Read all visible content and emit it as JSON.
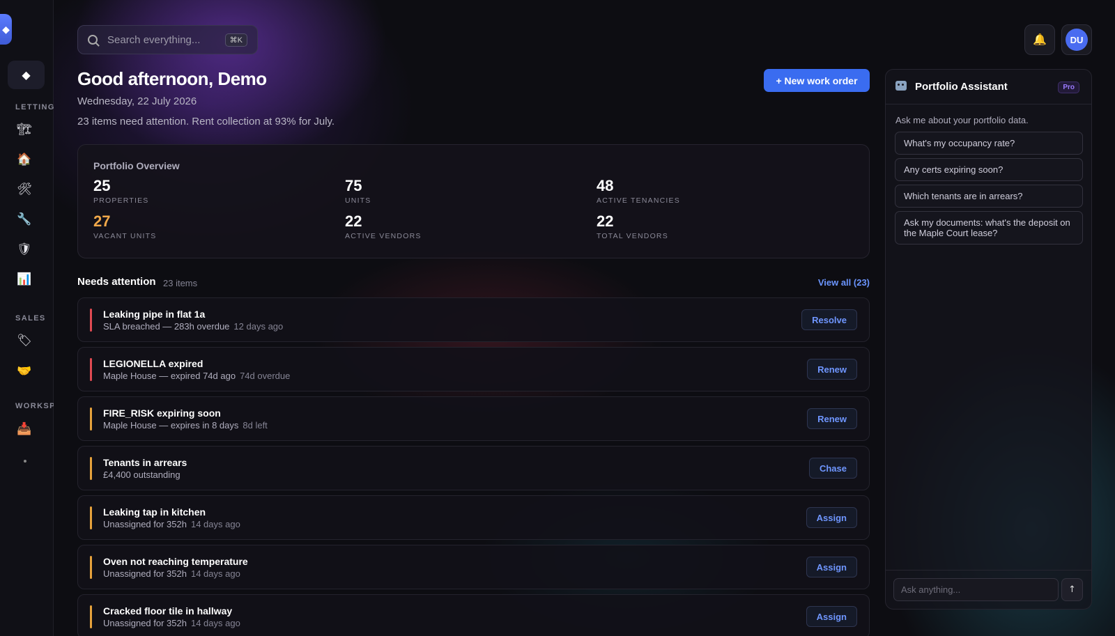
{
  "sidebar": {
    "sections": {
      "letting": "LETTING",
      "sales": "SALES",
      "workspace": "WORKSP"
    },
    "letting_icons": [
      "crane-icon",
      "house-icon",
      "hammer-wrench-icon",
      "wrench-icon",
      "shield-icon",
      "chart-icon"
    ],
    "sales_icons": [
      "tag-icon",
      "handshake-icon"
    ],
    "workspace_icons": [
      "inbox-tray-icon"
    ]
  },
  "search": {
    "placeholder": "Search everything...",
    "shortcut": "⌘K"
  },
  "user": {
    "initials": "DU"
  },
  "greeting": {
    "title": "Good afternoon, Demo",
    "date": "Wednesday, 22 July 2026",
    "summary": "23 items need attention. Rent collection at 93% for July."
  },
  "actions": {
    "new_work_order": "+ New work order"
  },
  "overview": {
    "title": "Portfolio Overview",
    "stats": [
      {
        "value": "25",
        "label": "PROPERTIES"
      },
      {
        "value": "75",
        "label": "UNITS"
      },
      {
        "value": "48",
        "label": "ACTIVE TENANCIES"
      },
      {
        "value": "27",
        "label": "VACANT UNITS"
      },
      {
        "value": "22",
        "label": "ACTIVE VENDORS"
      },
      {
        "value": "22",
        "label": "TOTAL VENDORS"
      }
    ]
  },
  "attention": {
    "title": "Needs attention",
    "count": "23 items",
    "view_all": "View all (23)",
    "items": [
      {
        "title": "Leaking pipe in flat 1a",
        "sub": "SLA breached — 283h overdue",
        "meta": "12 days ago",
        "action": "Resolve",
        "severity": "red"
      },
      {
        "title": "LEGIONELLA expired",
        "sub": "Maple House — expired 74d ago",
        "meta": "74d overdue",
        "action": "Renew",
        "severity": "red"
      },
      {
        "title": "FIRE_RISK expiring soon",
        "sub": "Maple House — expires in 8 days",
        "meta": "8d left",
        "action": "Renew",
        "severity": "amber"
      },
      {
        "title": "Tenants in arrears",
        "sub": "£4,400 outstanding",
        "meta": "",
        "action": "Chase",
        "severity": "amber"
      },
      {
        "title": "Leaking tap in kitchen",
        "sub": "Unassigned for 352h",
        "meta": "14 days ago",
        "action": "Assign",
        "severity": "amber"
      },
      {
        "title": "Oven not reaching temperature",
        "sub": "Unassigned for 352h",
        "meta": "14 days ago",
        "action": "Assign",
        "severity": "amber"
      },
      {
        "title": "Cracked floor tile in hallway",
        "sub": "Unassigned for 352h",
        "meta": "14 days ago",
        "action": "Assign",
        "severity": "amber"
      }
    ]
  },
  "assistant": {
    "title": "Portfolio Assistant",
    "badge": "Pro",
    "intro": "Ask me about your portfolio data.",
    "suggestions": [
      "What's my occupancy rate?",
      "Any certs expiring soon?",
      "Which tenants are in arrears?",
      "Ask my documents: what's the deposit on the Maple Court lease?"
    ],
    "input_placeholder": "Ask anything...",
    "send_icon": "arrow-up-icon"
  }
}
